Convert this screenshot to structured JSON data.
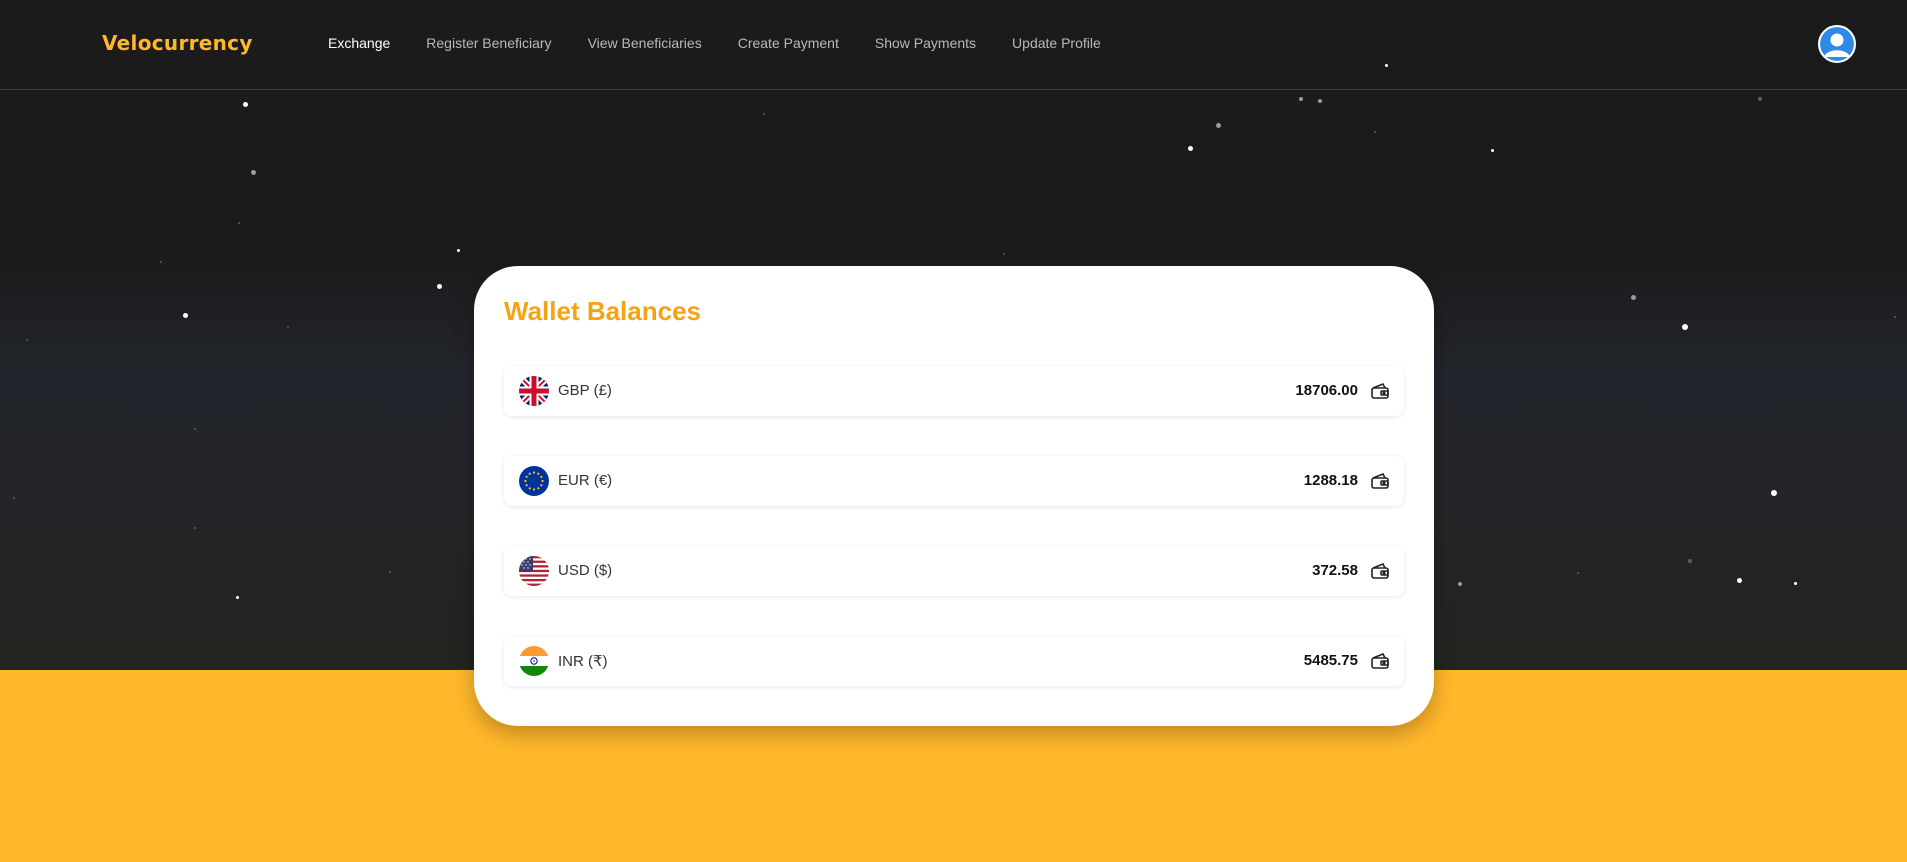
{
  "brand": "Velocurrency",
  "nav": [
    {
      "label": "Exchange",
      "active": true
    },
    {
      "label": "Register Beneficiary"
    },
    {
      "label": "View Beneficiaries"
    },
    {
      "label": "Create Payment"
    },
    {
      "label": "Show Payments"
    },
    {
      "label": "Update Profile"
    }
  ],
  "card": {
    "title": "Wallet Balances",
    "balances": [
      {
        "currency": "GBP (£)",
        "amount": "18706.00",
        "flag": "uk-flag-icon"
      },
      {
        "currency": "EUR (€)",
        "amount": "1288.18",
        "flag": "eu-flag-icon"
      },
      {
        "currency": "USD ($)",
        "amount": "372.58",
        "flag": "us-flag-icon"
      },
      {
        "currency": "INR (₹)",
        "amount": "5485.75",
        "flag": "india-flag-icon"
      }
    ]
  },
  "icons": {
    "avatar": "user-avatar-icon",
    "wallet": "wallet-icon"
  },
  "colors": {
    "accent": "#ffb72b",
    "title": "#f5a316",
    "background": "#1b1b1b"
  }
}
